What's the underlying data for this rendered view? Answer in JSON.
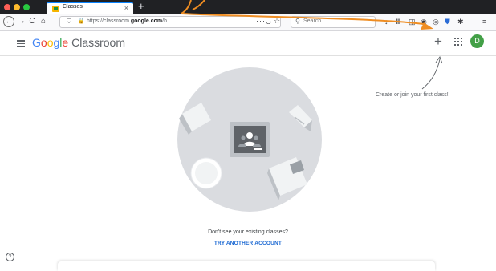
{
  "browser": {
    "tab": {
      "title": "Classes",
      "close": "×"
    },
    "new_tab": "+",
    "nav": {
      "back": "←",
      "forward": "→",
      "reload": "C",
      "home": "⌂"
    },
    "url": {
      "prefix": "https://classroom.",
      "domain": "google.com",
      "path": "/h"
    },
    "url_actions": "···",
    "search_placeholder": "Search",
    "toolbar_icons": [
      "download-icon",
      "library-icon",
      "sidebar-icon",
      "account-icon",
      "extension-icon",
      "shield-icon",
      "extension2-icon",
      "menu-icon"
    ]
  },
  "app": {
    "logo": {
      "google": [
        "G",
        "o",
        "o",
        "g",
        "l",
        "e"
      ],
      "product": "Classroom"
    },
    "plus": "+",
    "avatar": "D"
  },
  "main": {
    "hint": "Create or join your first class!",
    "no_classes": "Don't see your existing classes?",
    "try_another": "TRY ANOTHER ACCOUNT",
    "help": "?"
  },
  "colors": {
    "accent_blue": "#1967d2",
    "avatar_green": "#43a047",
    "annotation_orange": "#ef8d22"
  }
}
